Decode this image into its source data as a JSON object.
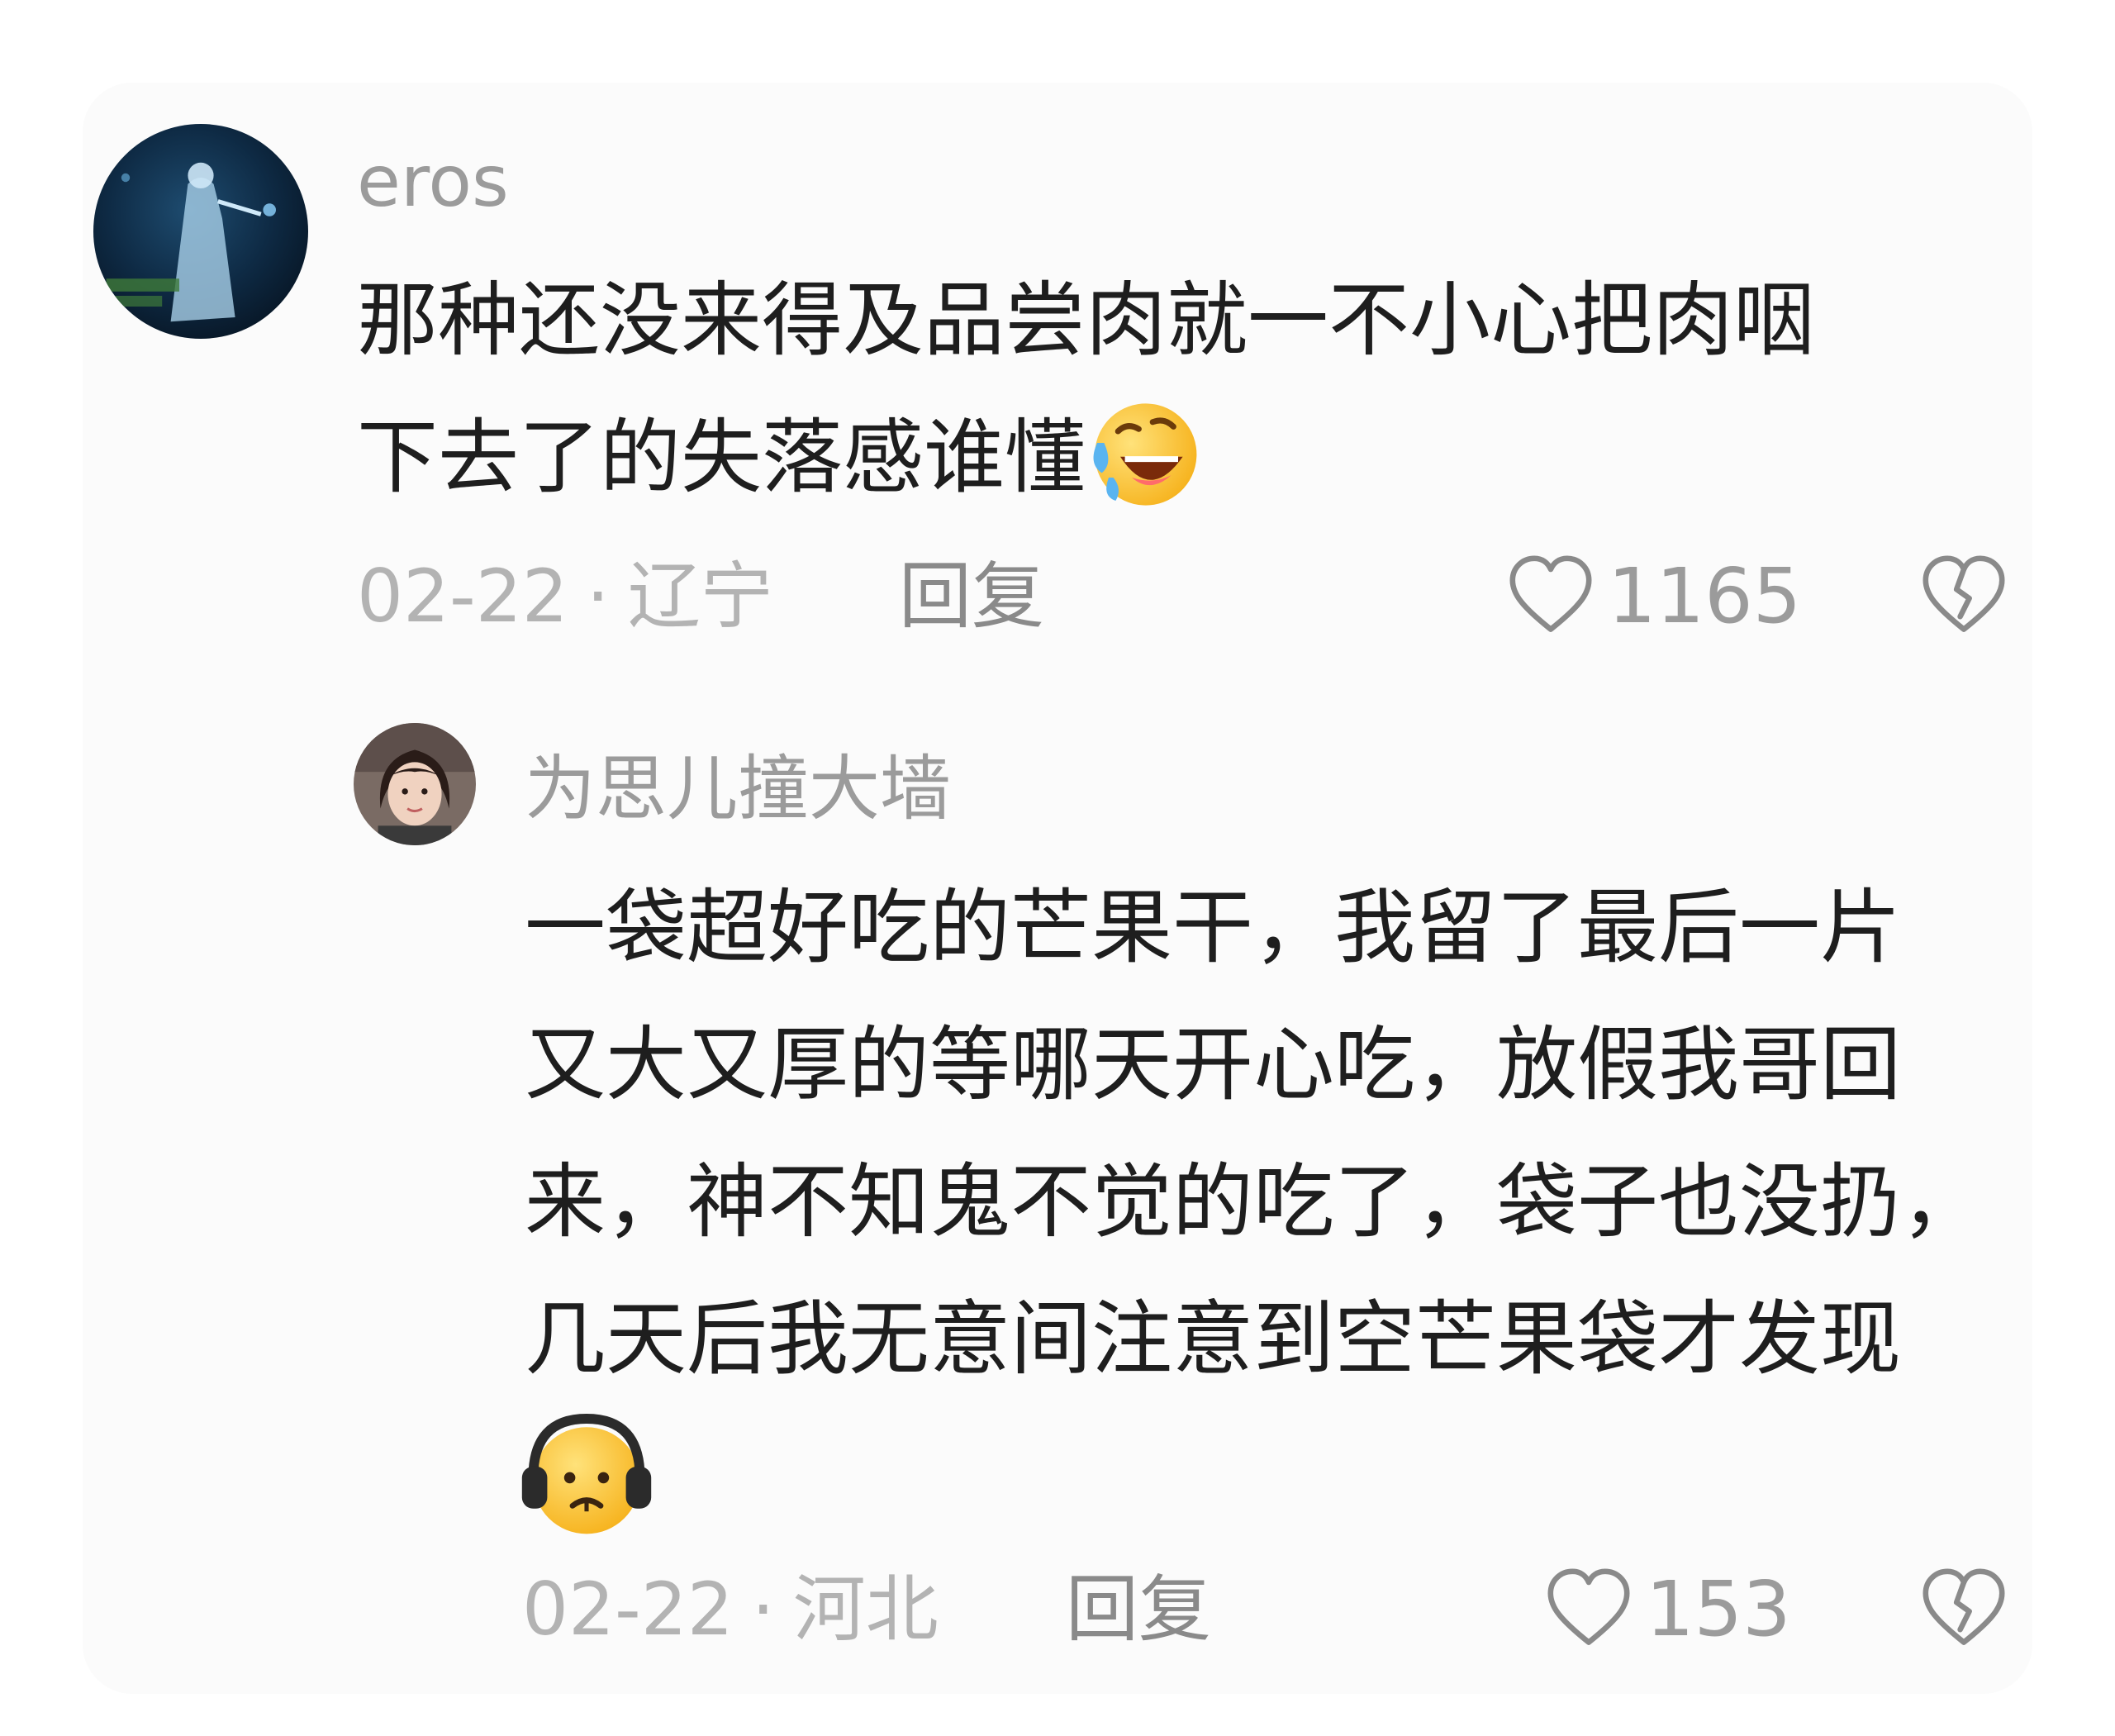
{
  "comments": {
    "main": {
      "username": "eros",
      "text_lines": [
        "那种还没来得及品尝肉就一不小心把肉咽",
        "下去了的失落感谁懂"
      ],
      "emoji": "rolling-on-floor-laughing-icon",
      "date": "02-22",
      "separator": "·",
      "location": "辽宁",
      "reply_label": "回复",
      "like_count": "1165"
    },
    "reply": {
      "username": "为思儿撞大墙",
      "text_lines": [
        "一袋超好吃的芒果干，我留了最后一片",
        "又大又厚的等哪天开心吃，放假我哥回",
        "来，神不知鬼不觉的吃了，袋子也没扔，",
        "几天后我无意间注意到空芒果袋才发现"
      ],
      "emoji": "headphones-sad-face-icon",
      "date": "02-22",
      "separator": "·",
      "location": "河北",
      "reply_label": "回复",
      "like_count": "153"
    }
  },
  "colors": {
    "text_primary": "#1e1e1e",
    "text_secondary": "#9b9b9b",
    "meta": "#b3b3b3",
    "icon_stroke": "#8a8a8a"
  }
}
